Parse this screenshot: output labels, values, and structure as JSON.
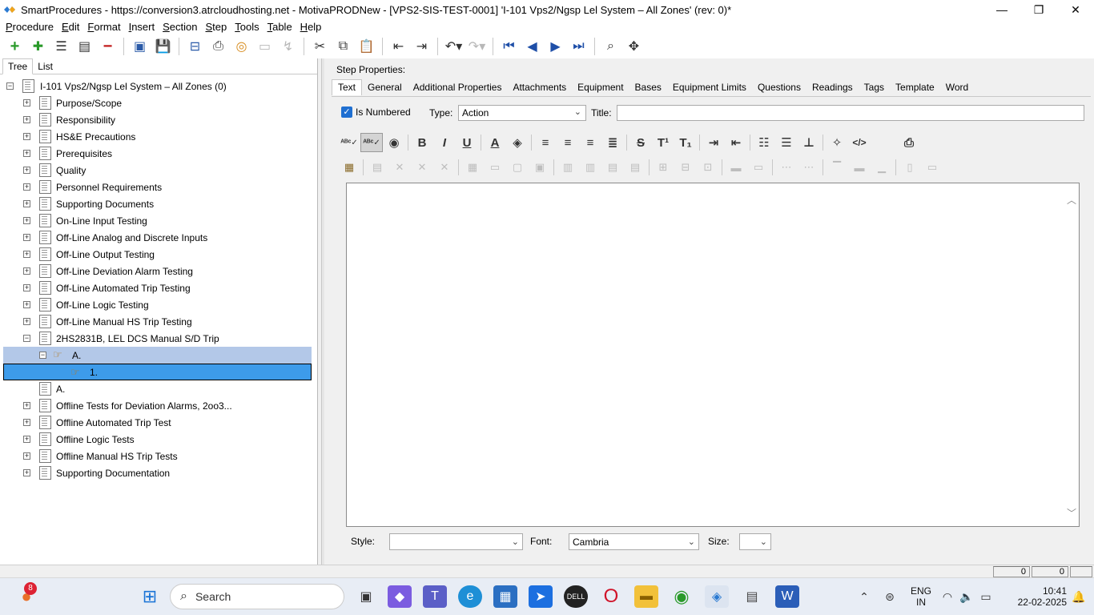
{
  "titlebar": {
    "title": "SmartProcedures - https://conversion3.atrcloudhosting.net - MotivaPRODNew - [VPS2-SIS-TEST-0001] 'I-101 Vps2/Ngsp Lel System – All Zones' (rev: 0)*",
    "minimize": "—",
    "maximize": "❐",
    "close": "✕"
  },
  "menu": [
    {
      "u": "P",
      "rest": "rocedure"
    },
    {
      "u": "E",
      "rest": "dit"
    },
    {
      "u": "F",
      "rest": "ormat"
    },
    {
      "u": "I",
      "rest": "nsert"
    },
    {
      "u": "S",
      "rest": "ection"
    },
    {
      "u": "S",
      "rest": "tep"
    },
    {
      "u": "T",
      "rest": "ools"
    },
    {
      "u": "T",
      "rest": "able"
    },
    {
      "u": "H",
      "rest": "elp"
    }
  ],
  "toolbar": {
    "icons": [
      "add-icon",
      "add-child-icon",
      "list-icon",
      "list-multi-icon",
      "remove-icon",
      "save-all-icon",
      "save-icon",
      "export-icon",
      "print-icon",
      "sync-icon",
      "preview-icon",
      "disabled-icon",
      "cut-icon",
      "copy-icon",
      "paste-icon",
      "indent-icon",
      "outdent-icon",
      "undo-icon",
      "redo-icon",
      "first-icon",
      "previous-icon",
      "next-icon",
      "last-icon",
      "find-icon",
      "move-icon"
    ]
  },
  "left_tabs": {
    "tree": "Tree",
    "list": "List"
  },
  "tree": {
    "root": "I-101 Vps2/Ngsp Lel System – All Zones (0)",
    "sections": [
      "Purpose/Scope",
      "Responsibility",
      "HS&E Precautions",
      "Prerequisites",
      "Quality",
      "Personnel Requirements",
      "Supporting Documents",
      "On-Line Input Testing",
      "Off-Line Analog and Discrete Inputs",
      "Off-Line Output Testing",
      "Off-Line Deviation Alarm Testing",
      "Off-Line Automated Trip Testing",
      "Off-Line Logic Testing",
      "Off-Line Manual HS Trip Testing",
      "2HS2831B, LEL DCS Manual S/D Trip"
    ],
    "step_a": "A.",
    "step_1": "1.",
    "section_a": "A.",
    "after_sections": [
      "Offline Tests for Deviation Alarms, 2oo3...",
      "Offline Automated Trip Test",
      "Offline Logic Tests",
      "Offline Manual HS Trip Tests",
      "Supporting Documentation"
    ]
  },
  "right": {
    "step_properties_label": "Step Properties:",
    "tabs": [
      "Text",
      "General",
      "Additional Properties",
      "Attachments",
      "Equipment",
      "Bases",
      "Equipment Limits",
      "Questions",
      "Readings",
      "Tags",
      "Template",
      "Word"
    ],
    "is_numbered_label": "Is Numbered",
    "is_numbered_checked": "✓",
    "type_label": "Type:",
    "type_value": "Action",
    "title_label": "Title:",
    "title_value": "",
    "style_label": "Style:",
    "style_value": "",
    "font_label": "Font:",
    "font_value": "Cambria",
    "size_label": "Size:",
    "size_value": ""
  },
  "statusbar": {
    "cell1": "0",
    "cell2": "0"
  },
  "taskbar": {
    "search_label": "Search",
    "notification_count": "8",
    "lang_top": "ENG",
    "lang_bottom": "IN",
    "time": "10:41",
    "date": "22-02-2025"
  }
}
